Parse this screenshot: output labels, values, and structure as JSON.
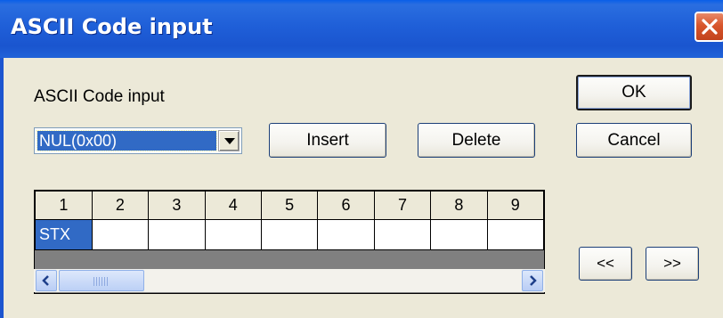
{
  "window": {
    "title": "ASCII Code input",
    "close_glyph": "✕"
  },
  "form": {
    "label": "ASCII Code input",
    "combo_value": "NUL(0x00)"
  },
  "buttons": {
    "ok": "OK",
    "cancel": "Cancel",
    "insert": "Insert",
    "delete": "Delete",
    "prev": "<<",
    "next": ">>"
  },
  "grid": {
    "columns": [
      "1",
      "2",
      "3",
      "4",
      "5",
      "6",
      "7",
      "8",
      "9"
    ],
    "cells": [
      "STX",
      "",
      "",
      "",
      "",
      "",
      "",
      "",
      ""
    ],
    "selected_index": 0
  },
  "icons": {
    "close": "close-icon",
    "dropdown": "chevron-down-icon",
    "scroll_left": "arrow-left-icon",
    "scroll_right": "arrow-right-icon"
  },
  "colors": {
    "titlebar": "#1f5fd8",
    "selection": "#316ac5",
    "close_button": "#d8552b",
    "dialog_background": "#ece9d8"
  }
}
